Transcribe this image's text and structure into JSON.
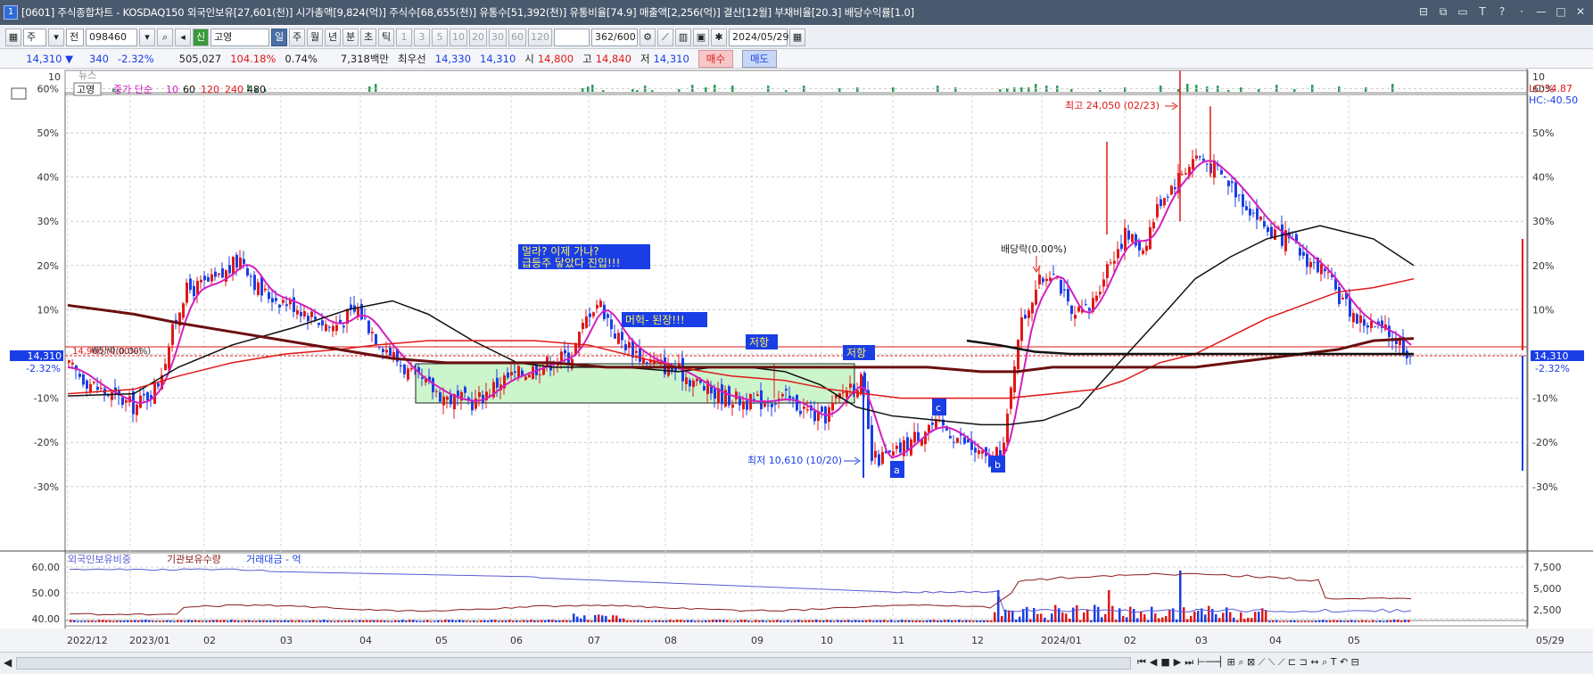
{
  "window": {
    "number": "1",
    "title": "[0601] 주식종합차트 - KOSDAQ150 외국인보유[27,601(천)] 시가총액[9,824(억)] 주식수[68,655(천)] 유통수[51,392(천)] 유통비율[74.9] 매출액[2,256(억)] 결산[12월] 부채비율[20.3] 배당수익률[1.0]"
  },
  "toolbar": {
    "market": "주",
    "scope": "전",
    "code": "098460",
    "badge": "신",
    "name": "고영",
    "periods": [
      "일",
      "주",
      "월",
      "년",
      "분",
      "초",
      "틱"
    ],
    "numbers": [
      "1",
      "3",
      "5",
      "10",
      "20",
      "30",
      "60",
      "120"
    ],
    "count": "362/600",
    "date": "2024/05/29"
  },
  "quote": {
    "price": "14,310 ▼",
    "change": "340",
    "pct": "-2.32%",
    "volume": "505,027",
    "vol_ratio": "104.18%",
    "turnover": "0.74%",
    "amount": "7,318백만",
    "pref_label": "최우선",
    "pref_ask": "14,330",
    "pref_bid": "14,310",
    "open_label": "시",
    "open": "14,800",
    "high_label": "고",
    "high": "14,840",
    "low_label": "저",
    "low": "14,310",
    "buy_label": "매수",
    "sell_label": "매도"
  },
  "news_panel": {
    "label": "뉴스",
    "axis_left": "10",
    "axis_right": "10"
  },
  "price_panel": {
    "stock_tag": "고영",
    "legend_prefix": "종가 단순",
    "ma_periods": [
      "10",
      "60",
      "120",
      "240",
      "480"
    ],
    "ma_colors": [
      "#d21fbf",
      "#111111",
      "#e01818",
      "#e01818",
      "#6a0f0f"
    ],
    "y_ticks": [
      "60%",
      "50%",
      "40%",
      "30%",
      "20%",
      "10%",
      "0%",
      "-10%",
      "-20%",
      "-30%"
    ],
    "lc_label": "LC:34.87",
    "hc_label": "HC:-40.50",
    "current_price_left": "14,310",
    "current_pct_left": "-2.32%",
    "current_price_right": "14,310",
    "current_pct_right": "-2.32%",
    "ref_label": "14,960 (0.00%)",
    "dividend_left": "배당락(0.00%)",
    "dividend_right": "배당락(0.00%)",
    "high_label": "최고 24,050 (02/23)",
    "low_label": "최저 10,610 (10/20)",
    "annotations": {
      "note1_line1": "멀라? 이제 가나?",
      "note1_line2": "급등주 닿았다 진입!!!",
      "note2": "머헉- 된장!!!",
      "resist1": "저항",
      "resist2": "저항",
      "wave_a": "a",
      "wave_b": "b",
      "wave_c": "c"
    }
  },
  "volume_panel": {
    "legend": [
      "외국인보유비중",
      "기관보유수량",
      "거래대금 - 억"
    ],
    "legend_colors": [
      "#5b5bd6",
      "#8b1a1a",
      "#1a3ee6"
    ],
    "y_left": [
      "60.00",
      "50.00",
      "40.00"
    ],
    "y_right": [
      "7,500",
      "5,000",
      "2,500"
    ]
  },
  "x_axis": {
    "labels": [
      "2022/12",
      "2023/01",
      "02",
      "03",
      "04",
      "05",
      "06",
      "07",
      "08",
      "09",
      "10",
      "11",
      "12",
      "2024/01",
      "02",
      "03",
      "04",
      "05"
    ],
    "right_label": "05/29"
  }
}
